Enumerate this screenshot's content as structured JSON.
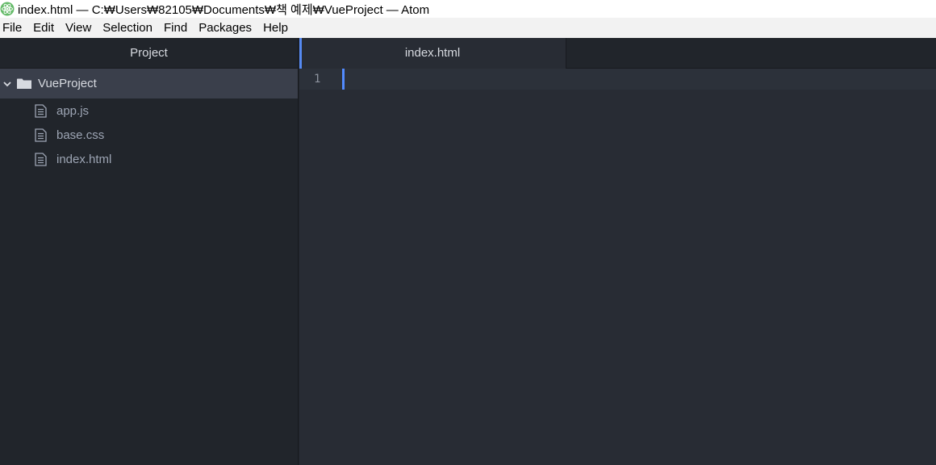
{
  "window": {
    "title": "index.html — C:₩Users₩82105₩Documents₩책 예제₩VueProject — Atom",
    "app_icon": "atom-icon"
  },
  "menu": {
    "items": [
      "File",
      "Edit",
      "View",
      "Selection",
      "Find",
      "Packages",
      "Help"
    ]
  },
  "sidebar": {
    "header": "Project",
    "root": {
      "label": "VueProject",
      "expanded": true,
      "icon": "folder-icon"
    },
    "files": [
      {
        "label": "app.js",
        "icon": "file-icon"
      },
      {
        "label": "base.css",
        "icon": "file-icon"
      },
      {
        "label": "index.html",
        "icon": "file-icon"
      }
    ]
  },
  "editor": {
    "tabs": [
      {
        "label": "index.html",
        "active": true
      }
    ],
    "line_numbers": [
      "1"
    ]
  },
  "colors": {
    "accent": "#568af2",
    "panel_bg": "#21252b",
    "editor_bg": "#282c34",
    "selected_bg": "#3a3f4b"
  }
}
